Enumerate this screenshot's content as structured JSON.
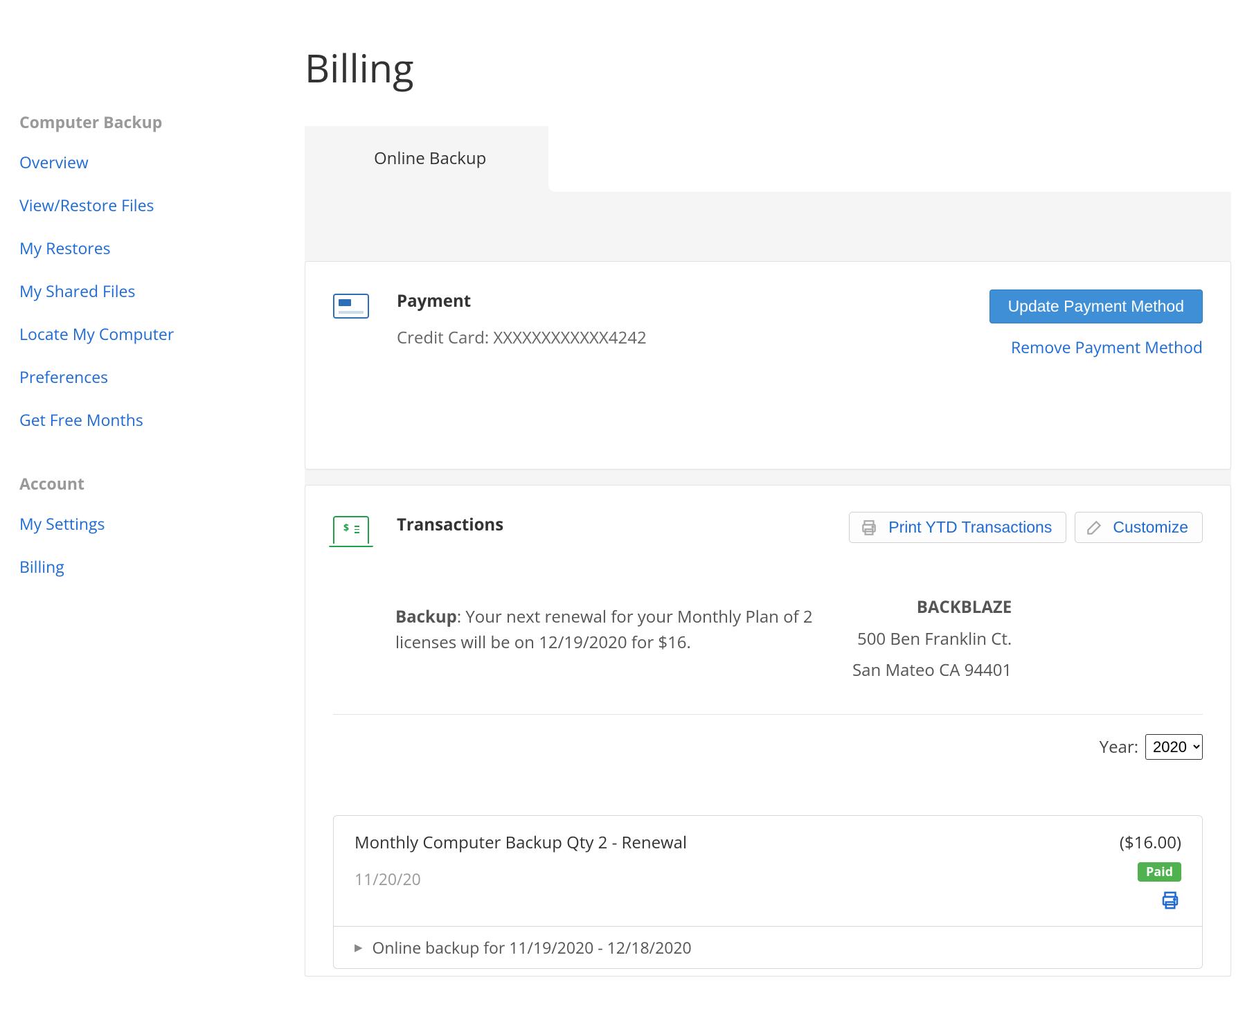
{
  "page": {
    "title": "Billing"
  },
  "sidebar": {
    "section1_title": "Computer Backup",
    "section1_items": [
      {
        "label": "Overview"
      },
      {
        "label": "View/Restore Files"
      },
      {
        "label": "My Restores"
      },
      {
        "label": "My Shared Files"
      },
      {
        "label": "Locate My Computer"
      },
      {
        "label": "Preferences"
      },
      {
        "label": "Get Free Months"
      }
    ],
    "section2_title": "Account",
    "section2_items": [
      {
        "label": "My Settings"
      },
      {
        "label": "Billing"
      }
    ]
  },
  "tabs": {
    "active": "Online Backup"
  },
  "payment": {
    "title": "Payment",
    "line": "Credit Card: XXXXXXXXXXXX4242",
    "update_btn": "Update Payment Method",
    "remove_link": "Remove Payment Method"
  },
  "transactions": {
    "title": "Transactions",
    "print_btn": "Print YTD Transactions",
    "customize_btn": "Customize",
    "backup_label": "Backup",
    "renewal_text": ":  Your next renewal for your Monthly Plan of 2 licenses will be on 12/19/2020 for $16.",
    "company": "BACKBLAZE",
    "addr1": "500 Ben Franklin Ct.",
    "addr2": "San Mateo CA 94401",
    "year_label": "Year:",
    "year_value": "2020",
    "items": [
      {
        "title": "Monthly Computer Backup Qty 2 - Renewal",
        "date": "11/20/20",
        "amount": "($16.00)",
        "badge": "Paid",
        "detail": "Online backup for 11/19/2020 - 12/18/2020"
      }
    ]
  }
}
